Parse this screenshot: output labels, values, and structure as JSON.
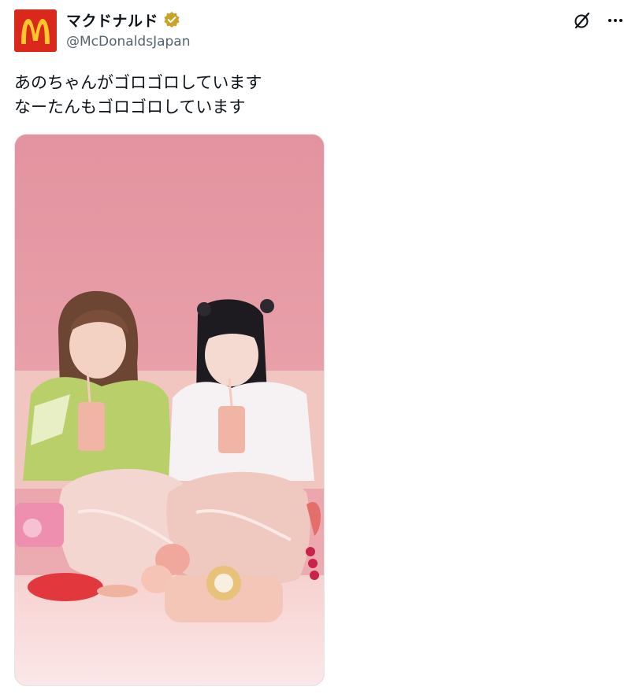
{
  "author": {
    "display_name": "マクドナルド",
    "handle": "@McDonaldsJapan",
    "avatar_icon": "mcdonalds-logo-icon",
    "verified_icon": "verified-badge-icon",
    "verified_color": "#c9a227"
  },
  "actions": {
    "grok_icon": "grok-icon",
    "more_icon": "more-options-icon"
  },
  "post": {
    "lines": [
      "あのちゃんがゴロゴロしています",
      "なーたんもゴロゴロしています"
    ]
  },
  "media": {
    "type": "image",
    "subject": "photo-two-people-with-drinks",
    "colors": {
      "background": "#e39aa6",
      "brand_red": "#da291c",
      "brand_yellow": "#ffc72c"
    }
  }
}
